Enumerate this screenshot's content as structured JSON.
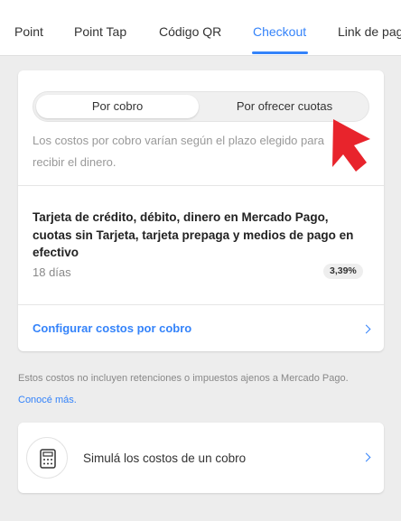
{
  "tabs": [
    {
      "label": "Point"
    },
    {
      "label": "Point Tap"
    },
    {
      "label": "Código QR"
    },
    {
      "label": "Checkout",
      "active": true
    },
    {
      "label": "Link de pago"
    }
  ],
  "segment": {
    "option_1": "Por cobro",
    "option_2": "Por ofrecer cuotas",
    "selected": "Por cobro"
  },
  "description": "Los costos por cobro varían según el plazo elegido para recibir el dinero.",
  "methods": "Tarjeta de crédito, débito, dinero en Mercado Pago, cuotas sin Tarjeta, tarjeta prepaga y medios de pago en efectivo",
  "days": "18 días",
  "rate": "3,39%",
  "config_link": "Configurar costos por cobro",
  "note": {
    "text": "Estos costos no incluyen retenciones o impuestos ajenos a Mercado Pago.",
    "link": "Conocé más."
  },
  "simulate_label": "Simulá los costos de un cobro",
  "colors": {
    "accent": "#3483fa",
    "background": "#ededed",
    "pointer": "#e8242c"
  },
  "icons": [
    "calculator-icon",
    "chevron-right-icon",
    "arrow-pointer-icon"
  ]
}
